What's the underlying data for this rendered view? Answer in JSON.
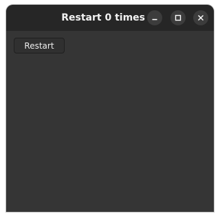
{
  "window": {
    "title": "Restart 0 times",
    "controls": {
      "minimize_icon": "minimize-icon",
      "maximize_icon": "maximize-icon",
      "close_icon": "close-icon"
    }
  },
  "content": {
    "restart_label": "Restart"
  },
  "colors": {
    "titlebar": "#262626",
    "background": "#353535",
    "button": "#303030",
    "text": "#eeeeee"
  }
}
